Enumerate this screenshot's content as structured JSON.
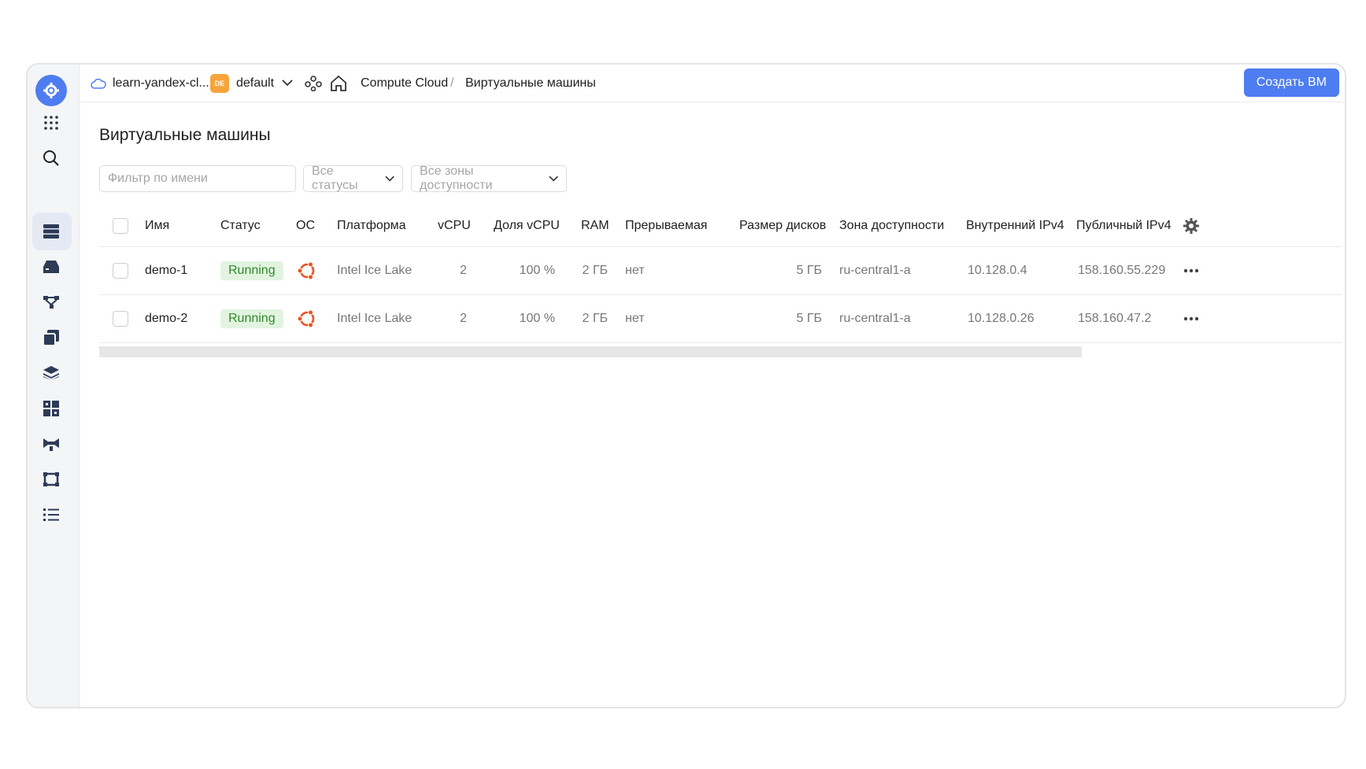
{
  "topbar": {
    "cloud_name": "learn-yandex-cl...",
    "folder_badge": "DE",
    "folder_name": "default",
    "service": "Compute Cloud",
    "separator": "/",
    "page": "Виртуальные машины",
    "create_button": "Создать ВМ"
  },
  "page_title": "Виртуальные машины",
  "filters": {
    "name_placeholder": "Фильтр по имени",
    "status_select": "Все статусы",
    "zone_select": "Все зоны доступности"
  },
  "table": {
    "columns": [
      "Имя",
      "Статус",
      "ОС",
      "Платформа",
      "vCPU",
      "Доля vCPU",
      "RAM",
      "Прерываемая",
      "Размер дисков",
      "Зона доступности",
      "Внутренний IPv4",
      "Публичный IPv4"
    ],
    "rows": [
      {
        "name": "demo-1",
        "status": "Running",
        "os": "ubuntu-icon",
        "platform": "Intel Ice Lake",
        "vcpu": "2",
        "vcpu_share": "100 %",
        "ram": "2 ГБ",
        "preemptible": "нет",
        "disk": "5 ГБ",
        "zone": "ru-central1-a",
        "internal_ip": "10.128.0.4",
        "public_ip": "158.160.55.229"
      },
      {
        "name": "demo-2",
        "status": "Running",
        "os": "ubuntu-icon",
        "platform": "Intel Ice Lake",
        "vcpu": "2",
        "vcpu_share": "100 %",
        "ram": "2 ГБ",
        "preemptible": "нет",
        "disk": "5 ГБ",
        "zone": "ru-central1-a",
        "internal_ip": "10.128.0.26",
        "public_ip": "158.160.47.2"
      }
    ]
  },
  "colors": {
    "accent": "#4e7df1",
    "status_running_bg": "#e2f4e0",
    "status_running_text": "#2f8a2b",
    "ubuntu": "#e95420",
    "folder_badge": "#f6a43b"
  }
}
